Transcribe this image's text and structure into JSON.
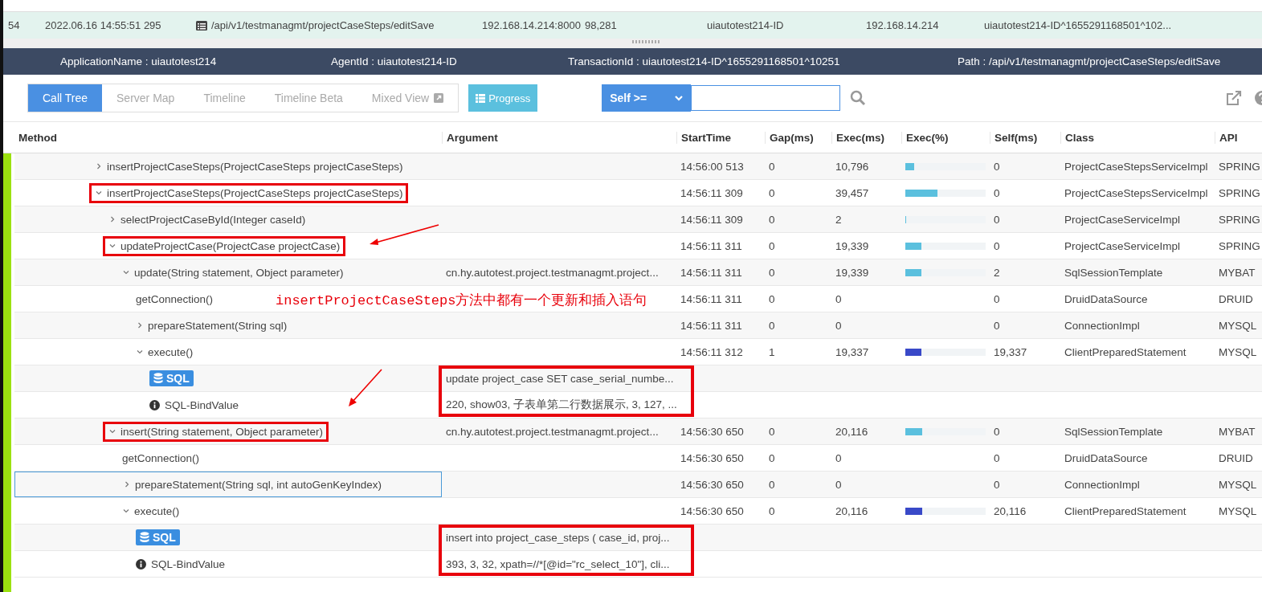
{
  "transaction_row": {
    "index": "54",
    "start_time": "2022.06.16 14:55:51 295",
    "path": "/api/v1/testmanagmt/projectCaseSteps/editSave",
    "end_point": "192.168.14.214:8000",
    "exec": "98,281",
    "agent_id": "uiautotest214-ID",
    "client_ip": "192.168.14.214",
    "transaction": "uiautotest214-ID^1655291168501^102..."
  },
  "info_bar": [
    "ApplicationName : uiautotest214",
    "AgentId : uiautotest214-ID",
    "TransactionId : uiautotest214-ID^1655291168501^10251",
    "Path : /api/v1/testmanagmt/projectCaseSteps/editSave"
  ],
  "tabs": [
    {
      "label": "Call Tree",
      "selected": true
    },
    {
      "label": "Server Map",
      "selected": false
    },
    {
      "label": "Timeline",
      "selected": false
    },
    {
      "label": "Timeline Beta",
      "selected": false
    },
    {
      "label": "Mixed View",
      "selected": false,
      "external": true
    }
  ],
  "progress_button": "Progress",
  "filter": {
    "label": "Self >="
  },
  "columns": [
    "Method",
    "Argument",
    "StartTime",
    "Gap(ms)",
    "Exec(ms)",
    "Exec(%)",
    "Self(ms)",
    "Class",
    "API"
  ],
  "rows": [
    {
      "kind": "method",
      "method": "insertProjectCaseSteps(ProjectCaseSteps projectCaseSteps)",
      "expanded": false,
      "boxed": false,
      "start_time": "14:56:00 513",
      "gap": "0",
      "exec": "10,796",
      "level": 0.11,
      "color": "#5bc0de",
      "self": "0",
      "class": "ProjectCaseStepsServiceImpl",
      "api": "SPRING"
    },
    {
      "kind": "method",
      "method": "insertProjectCaseSteps(ProjectCaseSteps projectCaseSteps)",
      "expanded": true,
      "boxed": true,
      "start_time": "14:56:11 309",
      "gap": "0",
      "exec": "39,457",
      "level": 0.4,
      "color": "#5bc0de",
      "self": "0",
      "class": "ProjectCaseStepsServiceImpl",
      "api": "SPRING",
      "children": [
        {
          "kind": "method",
          "method": "selectProjectCaseById(Integer caseId)",
          "expanded": false,
          "boxed": false,
          "start_time": "14:56:11 309",
          "gap": "0",
          "exec": "2",
          "level": 0.01,
          "color": "#5bc0de",
          "self": "0",
          "class": "ProjectCaseServiceImpl",
          "api": "SPRING"
        },
        {
          "kind": "method",
          "method": "updateProjectCase(ProjectCase projectCase)",
          "expanded": true,
          "boxed": true,
          "arrow": true,
          "start_time": "14:56:11 311",
          "gap": "0",
          "exec": "19,339",
          "level": 0.2,
          "color": "#5bc0de",
          "self": "0",
          "class": "ProjectCaseServiceImpl",
          "api": "SPRING",
          "children": [
            {
              "kind": "method",
              "method": "update(String statement, Object parameter)",
              "expanded": true,
              "boxed": false,
              "argument": "cn.hy.autotest.project.testmanagmt.project...",
              "start_time": "14:56:11 311",
              "gap": "0",
              "exec": "19,339",
              "level": 0.2,
              "color": "#5bc0de",
              "self": "2",
              "class": "SqlSessionTemplate",
              "api": "MYBAT",
              "children": [
                {
                  "kind": "method",
                  "method": "getConnection()",
                  "boxed": false,
                  "note": "insertProjectCaseSteps方法中都有一个更新和插入语句",
                  "start_time": "14:56:11 311",
                  "gap": "0",
                  "exec": "0",
                  "self": "0",
                  "class": "DruidDataSource",
                  "api": "DRUID"
                },
                {
                  "kind": "method",
                  "method": "prepareStatement(String sql)",
                  "expanded": false,
                  "boxed": false,
                  "start_time": "14:56:11 311",
                  "gap": "0",
                  "exec": "0",
                  "self": "0",
                  "class": "ConnectionImpl",
                  "api": "MYSQL"
                },
                {
                  "kind": "method",
                  "method": "execute()",
                  "expanded": true,
                  "boxed": false,
                  "start_time": "14:56:11 312",
                  "gap": "1",
                  "exec": "19,337",
                  "level": 0.2,
                  "color": "#3949c8",
                  "self": "19,337",
                  "class": "ClientPreparedStatement",
                  "api": "MYSQL",
                  "children": [
                    {
                      "kind": "sql",
                      "method": "SQL",
                      "argument": "update project_case SET case_serial_numbe...",
                      "argument_boxed": true
                    },
                    {
                      "kind": "bind",
                      "method": "SQL-BindValue",
                      "argument": "220, show03, 子表单第二行数据展示, 3, 127, ...",
                      "arrow": true
                    }
                  ]
                }
              ]
            }
          ]
        },
        {
          "kind": "method",
          "method": "insert(String statement, Object parameter)",
          "expanded": true,
          "boxed": true,
          "argument": "cn.hy.autotest.project.testmanagmt.project...",
          "start_time": "14:56:30 650",
          "gap": "0",
          "exec": "20,116",
          "level": 0.21,
          "color": "#5bc0de",
          "self": "0",
          "class": "SqlSessionTemplate",
          "api": "MYBAT",
          "children": [
            {
              "kind": "method",
              "method": "getConnection()",
              "boxed": false,
              "start_time": "14:56:30 650",
              "gap": "0",
              "exec": "0",
              "self": "0",
              "class": "DruidDataSource",
              "api": "DRUID"
            },
            {
              "kind": "method",
              "method": "prepareStatement(String sql, int autoGenKeyIndex)",
              "expanded": false,
              "boxed": false,
              "selected": true,
              "start_time": "14:56:30 650",
              "gap": "0",
              "exec": "0",
              "self": "0",
              "class": "ConnectionImpl",
              "api": "MYSQL"
            },
            {
              "kind": "method",
              "method": "execute()",
              "expanded": true,
              "boxed": false,
              "start_time": "14:56:30 650",
              "gap": "0",
              "exec": "20,116",
              "level": 0.21,
              "color": "#3949c8",
              "self": "20,116",
              "class": "ClientPreparedStatement",
              "api": "MYSQL",
              "children": [
                {
                  "kind": "sql",
                  "method": "SQL",
                  "argument": "insert into project_case_steps ( case_id, proj...",
                  "argument_boxed": true
                },
                {
                  "kind": "bind",
                  "method": "SQL-BindValue",
                  "argument": "393, 3, 32, xpath=//*[@id=\"rc_select_10\"], cli..."
                }
              ]
            }
          ]
        }
      ]
    }
  ]
}
